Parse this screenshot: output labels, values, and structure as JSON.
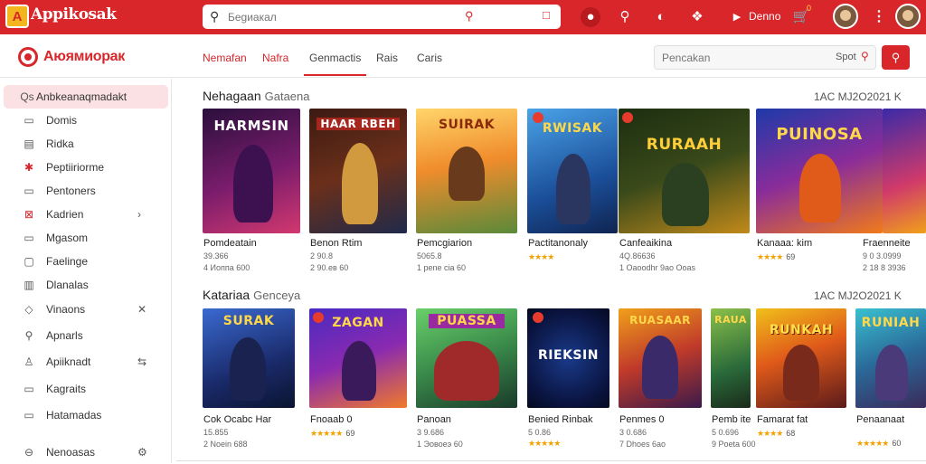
{
  "topbar": {
    "logo_glyph": "A",
    "title": "Appikosak",
    "search_placeholder": "Беgиакал",
    "cart_count": "0",
    "user_label": "Denno",
    "icons": [
      "search-icon",
      "shopping-bag-icon",
      "circle-icon",
      "search-icon",
      "headphones-icon",
      "controller-icon",
      "video-icon",
      "cart-icon",
      "avatar",
      "menu-dots-icon"
    ]
  },
  "subbar": {
    "brand": "Аюямиорак",
    "tabs": [
      "Nemafan",
      "Nafra",
      "Genmactis",
      "Rais",
      "Caris"
    ],
    "search_placeholder": "Pencakan",
    "search_label": "Spot"
  },
  "sidebar": {
    "items": [
      {
        "icon": "Qs",
        "label": "Anbkeanaqmadakt",
        "active": true
      },
      {
        "icon": "▭",
        "label": "Domis"
      },
      {
        "icon": "▤",
        "label": "Ridka"
      },
      {
        "icon": "✱",
        "label": "Peptiiriorme"
      },
      {
        "icon": "▭",
        "label": "Pentoners"
      },
      {
        "icon": "⊠",
        "label": "Kadrien",
        "arrow": "›"
      },
      {
        "icon": "▭",
        "label": "Mgasom"
      },
      {
        "icon": "▢",
        "label": "Faelinge"
      },
      {
        "icon": "▥",
        "label": "Dlanalas"
      },
      {
        "icon": "◇",
        "label": "Vinaons",
        "arrow": "✕"
      },
      {
        "icon": "⚲",
        "label": "Apnarls"
      },
      {
        "icon": "♙",
        "label": "Apiiknadt",
        "arrow": "⇆"
      },
      {
        "icon": "▭",
        "label": "Kagraits"
      },
      {
        "icon": "▭",
        "label": "Hatamadas"
      },
      {
        "icon": "⊖",
        "label": "Nenoasas",
        "arrow": "⚙"
      }
    ]
  },
  "sections": [
    {
      "title": "Nehagaan",
      "subtitle": "Gataena",
      "meta": "1AC  MJ2O2021  K",
      "games": [
        {
          "art": "HARMSIN",
          "title": "Pomdeatain",
          "line1": "39.366",
          "line2": "4 Иоппа 600"
        },
        {
          "art": "HAAR RBEH",
          "title": "Benon Rtim",
          "line1": "2 90.8",
          "line2": "2 90.ев 60"
        },
        {
          "art": "SUIRAK",
          "title": "Pemcgiarion",
          "line1": "5065.8",
          "line2": "1 pene cia 60"
        },
        {
          "art": "RWISAK",
          "title": "Pactitanonaly",
          "line1": "",
          "line2": "",
          "stars": "★★★★",
          "rating": ""
        },
        {
          "art": "RURAAH",
          "title": "Canfeaikina",
          "line1": "4Q.86636",
          "line2": "1 Oaoodhr 9ao Ooas"
        },
        {
          "art": "PUINOSA",
          "title": "Kanaaa: kim",
          "line1": "",
          "line2": "",
          "stars": "★★★★",
          "rating": "69"
        },
        {
          "art": "",
          "title": "Fraenneite",
          "line1": "9 0 3.0999",
          "line2": "2 18 8 3936"
        }
      ]
    },
    {
      "title": "Katariaa",
      "subtitle": "Genceya",
      "meta": "1AC  MJ2O2021  K",
      "games": [
        {
          "art": "SURAK",
          "title": "Cok Ocabc Har",
          "line1": "15.855",
          "line2": "2 Noein 688"
        },
        {
          "art": "ZAGAN",
          "title": "Fnoaab 0",
          "line1": "",
          "line2": "",
          "stars": "★★★★★",
          "rating": "69"
        },
        {
          "art": "PUASSA",
          "title": "Panoan",
          "line1": "3 9.686",
          "line2": "1 Эовоеэ 60"
        },
        {
          "art": "RIEKSIN",
          "title": "Benied Rinbak",
          "line1": "5 0.86",
          "line2": "",
          "stars": "★★★★★",
          "rating": ""
        },
        {
          "art": "RUASAAR",
          "title": "Penmes 0",
          "line1": "3 0.686",
          "line2": "7 Dhoes 6ao"
        },
        {
          "art": "RAUA",
          "title": "Pemb ite",
          "line1": "5 0.696",
          "line2": "9 Poeta 600"
        },
        {
          "art": "RUNKAH",
          "title": "Famarat fat",
          "line1": "",
          "line2": "",
          "stars": "★★★★",
          "rating": "68"
        },
        {
          "art": "RUNIAH",
          "title": "Penaanaat",
          "line1": "",
          "line2": "",
          "stars": "★★★★★",
          "rating": "60"
        }
      ]
    }
  ]
}
